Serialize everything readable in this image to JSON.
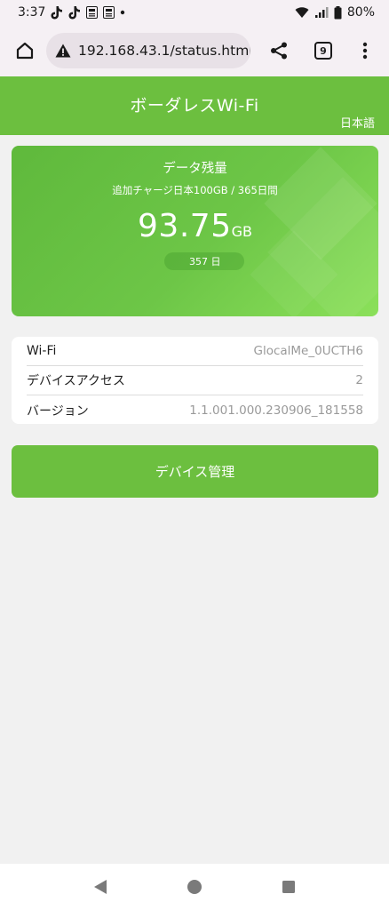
{
  "status_bar": {
    "time": "3:37",
    "battery": "80%"
  },
  "browser": {
    "url": "192.168.43.1/status.html",
    "tab_count": "9"
  },
  "header": {
    "title": "ボーダレスWi-Fi",
    "language": "日本語"
  },
  "data_card": {
    "title": "データ残量",
    "subtitle": "追加チャージ日本100GB / 365日間",
    "amount": "93.75",
    "unit": "GB",
    "days": "357 日"
  },
  "info": {
    "rows": [
      {
        "label": "Wi-Fi",
        "value": "GlocalMe_0UCTH6"
      },
      {
        "label": "デバイスアクセス",
        "value": "2"
      },
      {
        "label": "バージョン",
        "value": "1.1.001.000.230906_181558"
      }
    ]
  },
  "actions": {
    "manage_label": "デバイス管理"
  },
  "colors": {
    "accent": "#6cbf3f"
  }
}
